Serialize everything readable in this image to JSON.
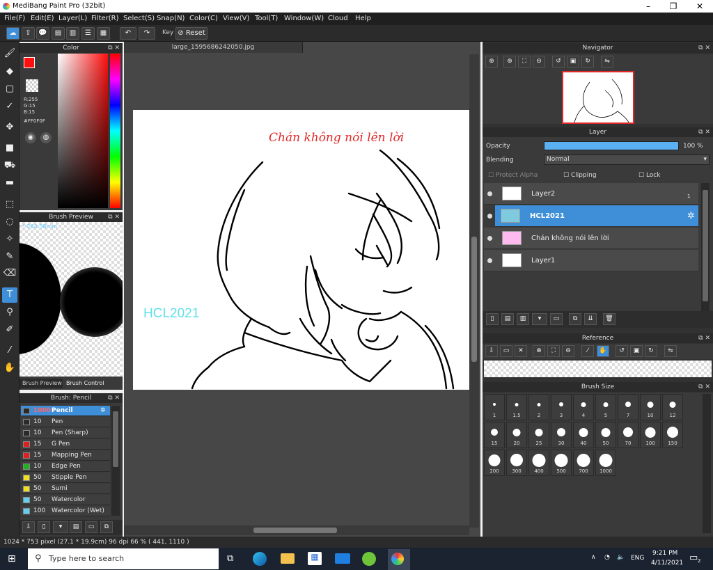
{
  "window": {
    "title": "MediBang Paint Pro (32bit)"
  },
  "menu": [
    "File(F)",
    "Edit(E)",
    "Layer(L)",
    "Filter(R)",
    "Select(S)",
    "Snap(N)",
    "Color(C)",
    "View(V)",
    "Tool(T)",
    "Window(W)",
    "Cloud",
    "Help"
  ],
  "toolbar": {
    "key_label": "Key",
    "reset_label": "Reset"
  },
  "color_panel": {
    "title": "Color",
    "r": "R:255",
    "g": "G:15",
    "b": "B:15",
    "hex": "#FF0F0F",
    "accent": "#ff0f0f"
  },
  "brush_preview": {
    "title": "Brush Preview",
    "size": "264.58mm",
    "tab1": "Brush Preview",
    "tab2": "Brush Control"
  },
  "brush_list": {
    "title": "Brush: Pencil",
    "items": [
      {
        "size": "1000",
        "name": "Pencil",
        "color": "#2a2a2a"
      },
      {
        "size": "10",
        "name": "Pen",
        "color": "#2a2a2a"
      },
      {
        "size": "10",
        "name": "Pen (Sharp)",
        "color": "#2a2a2a"
      },
      {
        "size": "15",
        "name": "G Pen",
        "color": "#e02020"
      },
      {
        "size": "15",
        "name": "Mapping Pen",
        "color": "#e02020"
      },
      {
        "size": "10",
        "name": "Edge Pen",
        "color": "#20b020"
      },
      {
        "size": "50",
        "name": "Stipple Pen",
        "color": "#f0e020"
      },
      {
        "size": "50",
        "name": "Sumi",
        "color": "#f0e020"
      },
      {
        "size": "50",
        "name": "Watercolor",
        "color": "#60d0f0"
      },
      {
        "size": "100",
        "name": "Watercolor (Wet)",
        "color": "#60d0f0"
      }
    ]
  },
  "document": {
    "tab": "large_1595686242050.jpg",
    "title_text": "Chán không nói lên lời",
    "signature": "HCL2021"
  },
  "navigator": {
    "title": "Navigator"
  },
  "layer_panel": {
    "title": "Layer",
    "opacity_label": "Opacity",
    "opacity_value": "100 %",
    "opacity": 1.0,
    "blending_label": "Blending",
    "blending_value": "Normal",
    "protect_alpha": "Protect Alpha",
    "clipping": "Clipping",
    "lock": "Lock",
    "layers": [
      {
        "name": "Layer2",
        "badge": "1"
      },
      {
        "name": "HCL2021"
      },
      {
        "name": "Chán không nói lên lời"
      },
      {
        "name": "Layer1"
      }
    ]
  },
  "reference": {
    "title": "Reference"
  },
  "brush_size": {
    "title": "Brush Size",
    "sizes": [
      "1",
      "1.5",
      "2",
      "3",
      "4",
      "5",
      "7",
      "10",
      "12",
      "15",
      "20",
      "25",
      "30",
      "40",
      "50",
      "70",
      "100",
      "150",
      "200",
      "300",
      "400",
      "500",
      "700",
      "1000"
    ]
  },
  "status": {
    "text": "1024 * 753 pixel  (27.1 * 19.9cm)  96 dpi  66 %  ( 441, 1110 )"
  },
  "taskbar": {
    "search_placeholder": "Type here to search",
    "lang": "ENG",
    "time": "9:21 PM",
    "date": "4/11/2021",
    "notif": "2"
  }
}
